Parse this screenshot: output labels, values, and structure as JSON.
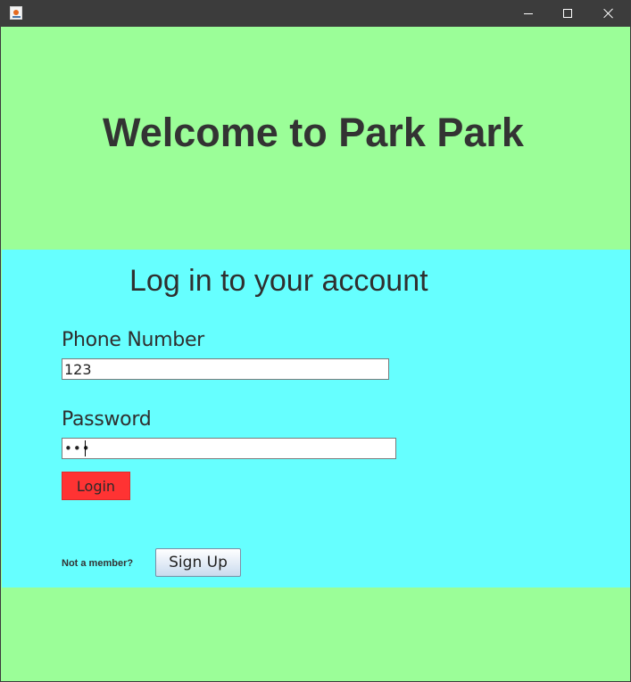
{
  "window": {
    "icon": "java-app-icon",
    "controls": {
      "minimize": "minimize-icon",
      "maximize": "maximize-icon",
      "close": "close-icon"
    }
  },
  "header": {
    "title": "Welcome to Park Park"
  },
  "login": {
    "heading": "Log in to your account",
    "phone_label": "Phone Number",
    "phone_value": "123",
    "password_label": "Password",
    "password_value": "•••",
    "login_button": "Login",
    "not_member_text": "Not a member?",
    "signup_button": "Sign Up"
  },
  "colors": {
    "header_bg": "#9bfe98",
    "login_panel_bg": "#66ffff",
    "login_button_bg": "#ff3333",
    "titlebar_bg": "#3c3c3c"
  }
}
